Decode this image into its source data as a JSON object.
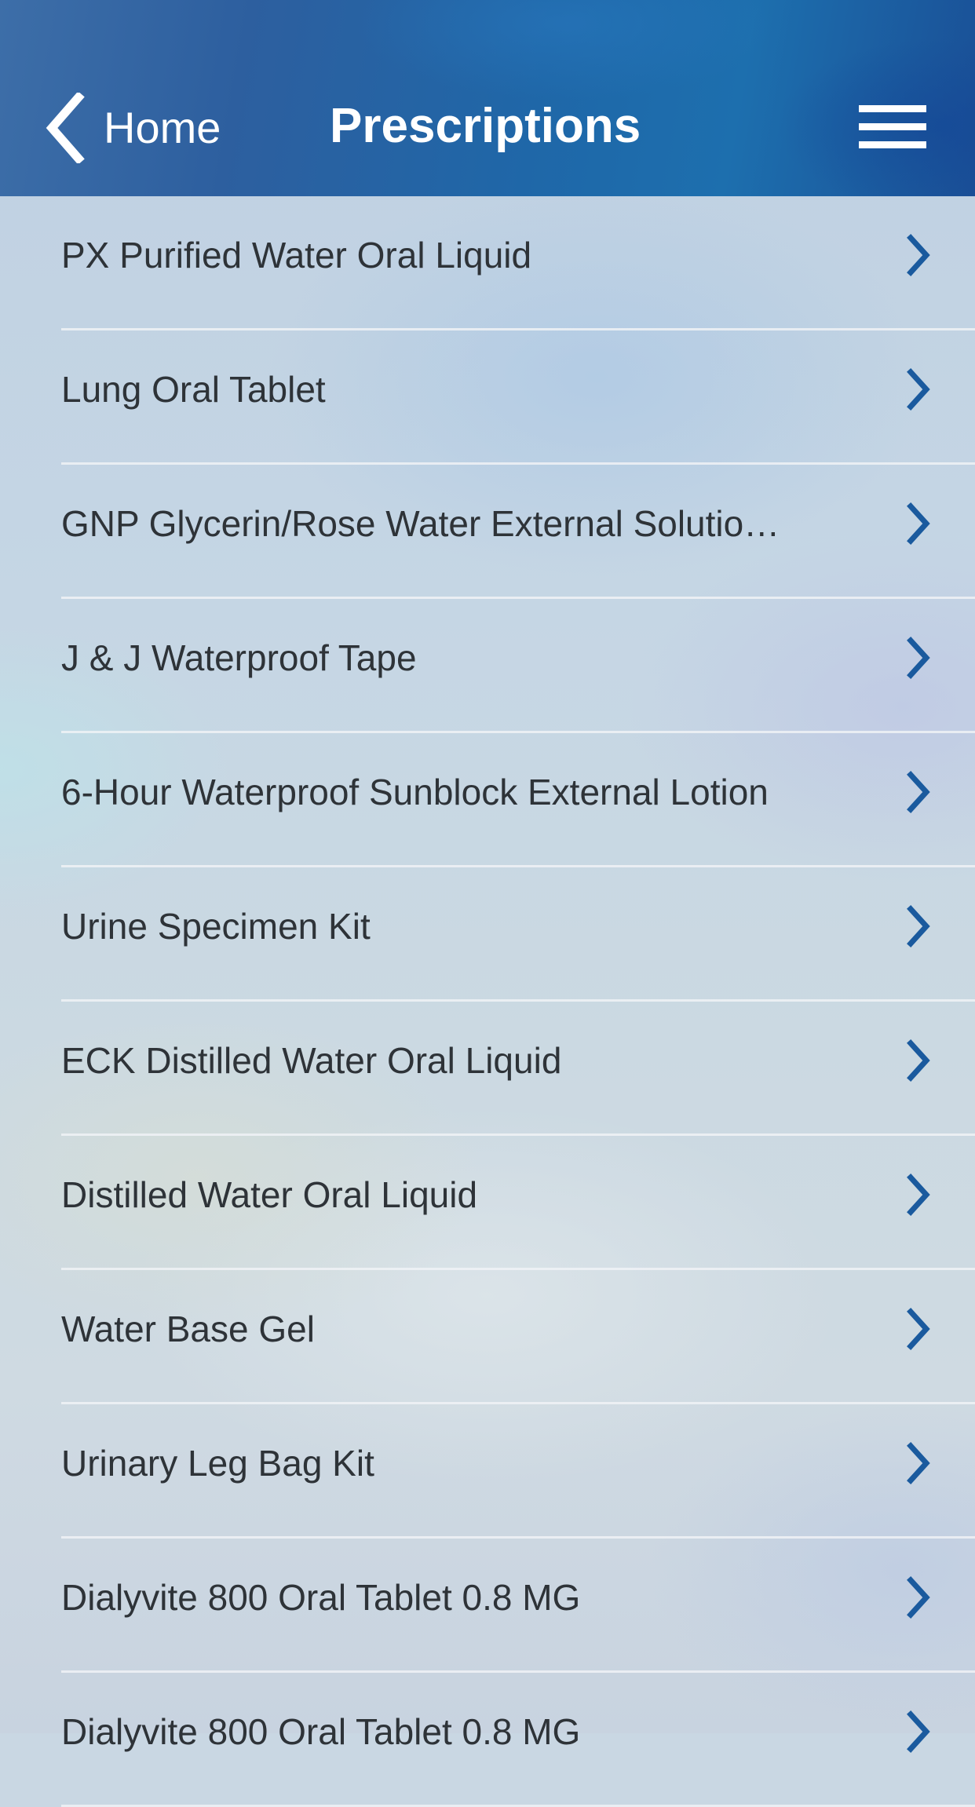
{
  "header": {
    "back_label": "Home",
    "title": "Prescriptions",
    "menu_icon": "hamburger-menu-icon",
    "back_icon": "chevron-left-icon"
  },
  "colors": {
    "header_blue": "#1f67a8",
    "chevron_blue": "#1a5a9e",
    "item_text": "#2e3338"
  },
  "list": {
    "row_icon": "chevron-right-icon",
    "items": [
      {
        "label": "PX Purified Water Oral Liquid"
      },
      {
        "label": "Lung Oral Tablet"
      },
      {
        "label": "GNP Glycerin/Rose Water External Solutio…"
      },
      {
        "label": "J & J Waterproof Tape"
      },
      {
        "label": "6-Hour Waterproof Sunblock External Lotion"
      },
      {
        "label": "Urine Specimen Kit"
      },
      {
        "label": "ECK Distilled Water Oral Liquid"
      },
      {
        "label": "Distilled Water Oral Liquid"
      },
      {
        "label": "Water Base Gel"
      },
      {
        "label": "Urinary Leg Bag Kit"
      },
      {
        "label": "Dialyvite 800 Oral Tablet 0.8 MG"
      },
      {
        "label": "Dialyvite 800 Oral Tablet 0.8 MG"
      }
    ]
  }
}
